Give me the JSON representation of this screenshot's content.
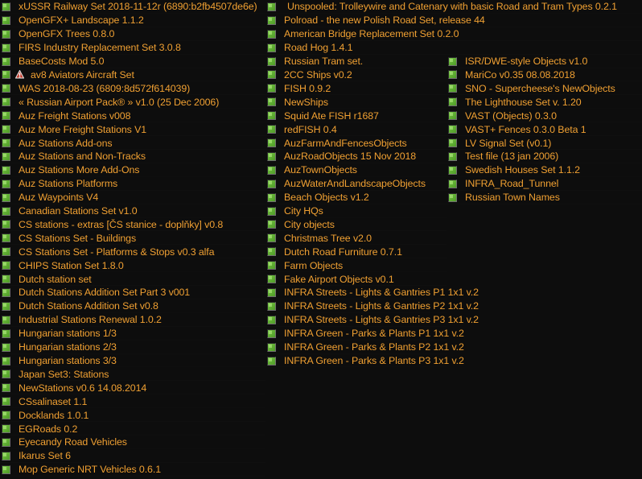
{
  "window": {
    "title": "NewGRF Settings - active list",
    "background_color": "#0d0d0d",
    "text_color": "#f0a032",
    "checkbox_color": "#63b135",
    "warning_color": "#c83232"
  },
  "columns": [
    {
      "name": "column-left",
      "items": [
        {
          "label": "xUSSR Railway Set 2018-11-12r (6890:b2fb4507de6e)",
          "enabled": true,
          "warning": false
        },
        {
          "label": "OpenGFX+ Landscape 1.1.2",
          "enabled": true,
          "warning": false
        },
        {
          "label": "OpenGFX Trees 0.8.0",
          "enabled": true,
          "warning": false
        },
        {
          "label": "FIRS Industry Replacement Set 3.0.8",
          "enabled": true,
          "warning": false
        },
        {
          "label": "BaseCosts Mod 5.0",
          "enabled": true,
          "warning": false
        },
        {
          "label": "av8 Aviators Aircraft Set",
          "enabled": true,
          "warning": true
        },
        {
          "label": "WAS 2018-08-23 (6809:8d572f614039)",
          "enabled": true,
          "warning": false
        },
        {
          "label": "« Russian Airport Pack® »  v1.0 (25 Dec 2006)",
          "enabled": true,
          "warning": false
        },
        {
          "label": "Auz Freight Stations v008",
          "enabled": true,
          "warning": false
        },
        {
          "label": "Auz More Freight Stations V1",
          "enabled": true,
          "warning": false
        },
        {
          "label": "Auz Stations Add-ons",
          "enabled": true,
          "warning": false
        },
        {
          "label": "Auz Stations and Non-Tracks",
          "enabled": true,
          "warning": false
        },
        {
          "label": "Auz Stations More Add-Ons",
          "enabled": true,
          "warning": false
        },
        {
          "label": "Auz Stations Platforms",
          "enabled": true,
          "warning": false
        },
        {
          "label": "Auz Waypoints V4",
          "enabled": true,
          "warning": false
        },
        {
          "label": "Canadian Stations Set v1.0",
          "enabled": true,
          "warning": false
        },
        {
          "label": "CS stations - extras [ČS stanice - doplňky] v0.8",
          "enabled": true,
          "warning": false
        },
        {
          "label": "CS Stations Set - Buildings",
          "enabled": true,
          "warning": false
        },
        {
          "label": "CS Stations Set - Platforms & Stops v0.3 alfa",
          "enabled": true,
          "warning": false
        },
        {
          "label": "CHIPS Station Set 1.8.0",
          "enabled": true,
          "warning": false
        },
        {
          "label": "Dutch station set",
          "enabled": true,
          "warning": false
        },
        {
          "label": "Dutch Stations Addition Set Part 3 v001",
          "enabled": true,
          "warning": false
        },
        {
          "label": "Dutch Stations Addition Set v0.8",
          "enabled": true,
          "warning": false
        },
        {
          "label": "Industrial Stations Renewal 1.0.2",
          "enabled": true,
          "warning": false
        },
        {
          "label": "Hungarian stations 1/3",
          "enabled": true,
          "warning": false
        },
        {
          "label": "Hungarian stations 2/3",
          "enabled": true,
          "warning": false
        },
        {
          "label": "Hungarian stations 3/3",
          "enabled": true,
          "warning": false
        },
        {
          "label": "Japan Set3: Stations",
          "enabled": true,
          "warning": false
        },
        {
          "label": "NewStations v0.6 14.08.2014",
          "enabled": true,
          "warning": false
        },
        {
          "label": "CSsalinaset 1.1",
          "enabled": true,
          "warning": false
        },
        {
          "label": "Docklands 1.0.1",
          "enabled": true,
          "warning": false
        },
        {
          "label": "EGRoads 0.2",
          "enabled": true,
          "warning": false
        },
        {
          "label": "Eyecandy Road Vehicles",
          "enabled": true,
          "warning": false
        },
        {
          "label": "Ikarus Set 6",
          "enabled": true,
          "warning": false
        },
        {
          "label": "Mop Generic NRT Vehicles 0.6.1",
          "enabled": true,
          "warning": false
        }
      ]
    },
    {
      "name": "column-middle",
      "items": [
        {
          "label": "Unspooled: Trolleywire and Catenary with basic Road and Tram Types 0.2.1",
          "enabled": true,
          "warning": false,
          "indent": true
        },
        {
          "label": "Polroad - the new Polish Road Set, release 44",
          "enabled": true,
          "warning": false
        },
        {
          "label": "American Bridge Replacement Set 0.2.0",
          "enabled": true,
          "warning": false
        },
        {
          "label": "Road Hog 1.4.1",
          "enabled": true,
          "warning": false
        },
        {
          "label": "Russian Tram set.",
          "enabled": true,
          "warning": false
        },
        {
          "label": "2CC Ships v0.2",
          "enabled": true,
          "warning": false
        },
        {
          "label": "FISH 0.9.2",
          "enabled": true,
          "warning": false
        },
        {
          "label": "NewShips",
          "enabled": true,
          "warning": false
        },
        {
          "label": "Squid Ate FISH r1687",
          "enabled": true,
          "warning": false
        },
        {
          "label": "redFISH 0.4",
          "enabled": true,
          "warning": false
        },
        {
          "label": "AuzFarmAndFencesObjects",
          "enabled": true,
          "warning": false
        },
        {
          "label": "AuzRoadObjects 15 Nov 2018",
          "enabled": true,
          "warning": false
        },
        {
          "label": "AuzTownObjects",
          "enabled": true,
          "warning": false
        },
        {
          "label": "AuzWaterAndLandscapeObjects",
          "enabled": true,
          "warning": false
        },
        {
          "label": "Beach Objects v1.2",
          "enabled": true,
          "warning": false
        },
        {
          "label": "City HQs",
          "enabled": true,
          "warning": false
        },
        {
          "label": "City objects",
          "enabled": true,
          "warning": false
        },
        {
          "label": "Christmas Tree v2.0",
          "enabled": true,
          "warning": false
        },
        {
          "label": "Dutch Road Furniture 0.7.1",
          "enabled": true,
          "warning": false
        },
        {
          "label": "Farm Objects",
          "enabled": true,
          "warning": false
        },
        {
          "label": "Fake Airport Objects v0.1",
          "enabled": true,
          "warning": false
        },
        {
          "label": "INFRA Streets - Lights & Gantries P1 1x1 v.2",
          "enabled": true,
          "warning": false
        },
        {
          "label": "INFRA Streets - Lights & Gantries P2 1x1 v.2",
          "enabled": true,
          "warning": false
        },
        {
          "label": "INFRA Streets - Lights & Gantries P3 1x1 v.2",
          "enabled": true,
          "warning": false
        },
        {
          "label": "INFRA Green - Parks & Plants P1 1x1 v.2",
          "enabled": true,
          "warning": false
        },
        {
          "label": "INFRA Green - Parks & Plants P2 1x1 v.2",
          "enabled": true,
          "warning": false
        },
        {
          "label": "INFRA Green - Parks & Plants P3 1x1 v.2",
          "enabled": true,
          "warning": false
        }
      ]
    },
    {
      "name": "column-right",
      "top_offset_rows": 4,
      "items": [
        {
          "label": "ISR/DWE-style Objects v1.0",
          "enabled": true,
          "warning": false
        },
        {
          "label": "MariCo v0.35 08.08.2018",
          "enabled": true,
          "warning": false
        },
        {
          "label": "SNO - Supercheese's NewObjects",
          "enabled": true,
          "warning": false
        },
        {
          "label": "The Lighthouse Set v. 1.20",
          "enabled": true,
          "warning": false
        },
        {
          "label": "VAST (Objects) 0.3.0",
          "enabled": true,
          "warning": false
        },
        {
          "label": "VAST+ Fences 0.3.0 Beta 1",
          "enabled": true,
          "warning": false
        },
        {
          "label": "LV Signal Set (v0.1)",
          "enabled": true,
          "warning": false
        },
        {
          "label": "Test file (13 jan 2006)",
          "enabled": true,
          "warning": false
        },
        {
          "label": "Swedish Houses Set 1.1.2",
          "enabled": true,
          "warning": false
        },
        {
          "label": "INFRA_Road_Tunnel",
          "enabled": true,
          "warning": false
        },
        {
          "label": "Russian Town Names",
          "enabled": true,
          "warning": false
        }
      ]
    }
  ]
}
